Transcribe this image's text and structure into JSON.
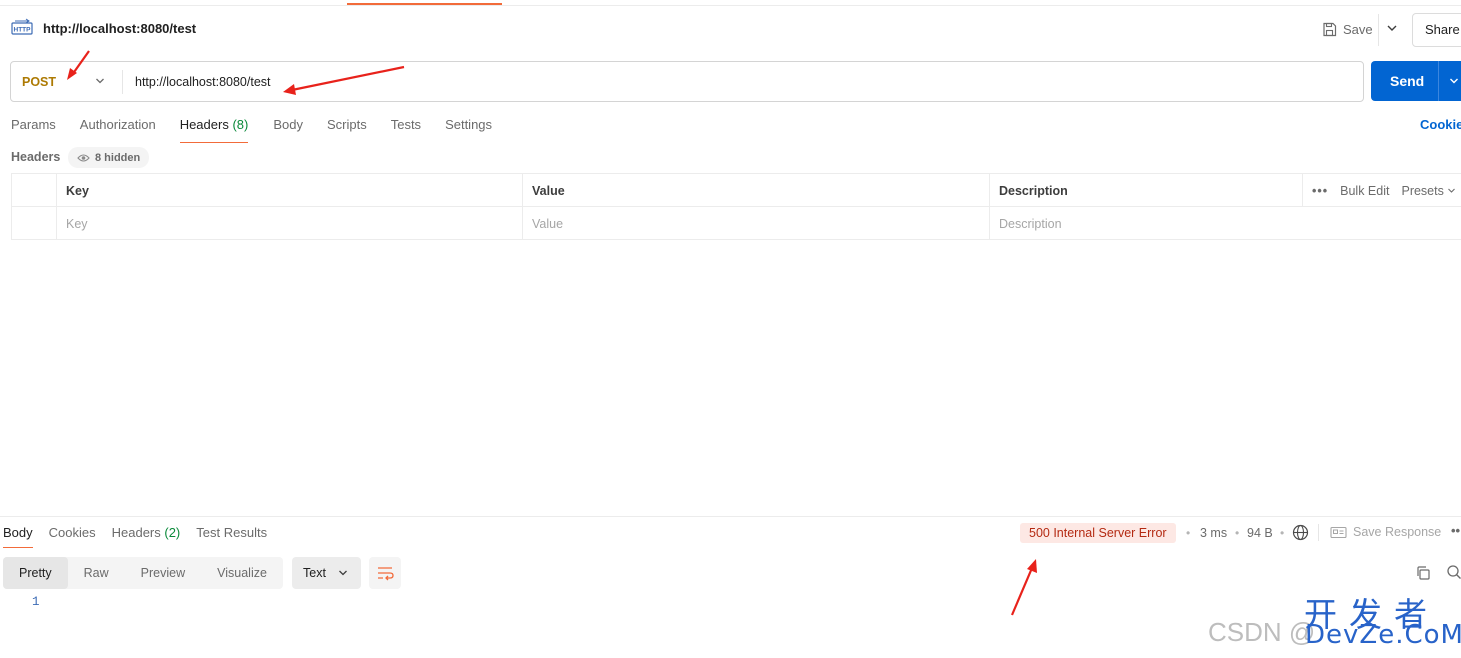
{
  "request": {
    "title": "http://localhost:8080/test",
    "save_label": "Save",
    "share_label": "Share",
    "method": "POST",
    "url": "http://localhost:8080/test",
    "send_label": "Send"
  },
  "request_tabs": [
    {
      "label": "Params"
    },
    {
      "label": "Authorization"
    },
    {
      "label": "Headers",
      "count": "(8)"
    },
    {
      "label": "Body"
    },
    {
      "label": "Scripts"
    },
    {
      "label": "Tests"
    },
    {
      "label": "Settings"
    }
  ],
  "cookies_label": "Cookie",
  "headers": {
    "label": "Headers",
    "hidden_label": "8 hidden",
    "columns": [
      "Key",
      "Value",
      "Description"
    ],
    "bulk_edit_label": "Bulk Edit",
    "presets_label": "Presets",
    "placeholders": {
      "key": "Key",
      "value": "Value",
      "description": "Description"
    }
  },
  "response": {
    "tabs": [
      {
        "label": "Body"
      },
      {
        "label": "Cookies"
      },
      {
        "label": "Headers",
        "count": "(2)"
      },
      {
        "label": "Test Results"
      }
    ],
    "status": "500 Internal Server Error",
    "time": "3 ms",
    "size": "94 B",
    "save_response_label": "Save Response",
    "view_modes": [
      "Pretty",
      "Raw",
      "Preview",
      "Visualize"
    ],
    "format": "Text",
    "line_number": "1"
  },
  "watermark": {
    "csdn": "CSDN @",
    "devze_cn": "开发者",
    "devze_en": "DevZe.CoM"
  },
  "colors": {
    "send": "#0265d2",
    "method": "#ad7a03",
    "accent": "#f26b3a",
    "error": "#b42a12",
    "annotation": "#e8221b"
  }
}
